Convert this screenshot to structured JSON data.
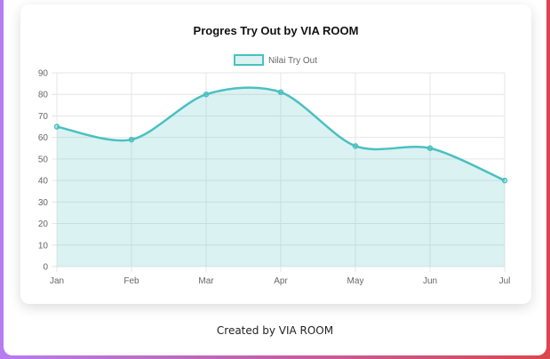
{
  "colors": {
    "line": "#4bc0c0",
    "fill": "rgba(75,192,192,0.2)",
    "grid": "#e6e6e6",
    "tick": "#666666"
  },
  "chart_data": {
    "type": "line",
    "title": "Progres Try Out by VIA ROOM",
    "categories": [
      "Jan",
      "Feb",
      "Mar",
      "Apr",
      "May",
      "Jun",
      "Jul"
    ],
    "series": [
      {
        "name": "Nilai Try Out",
        "values": [
          65,
          59,
          80,
          81,
          56,
          55,
          40
        ]
      }
    ],
    "ylim": [
      0,
      90
    ],
    "yticks": [
      0,
      10,
      20,
      30,
      40,
      50,
      60,
      70,
      80,
      90
    ],
    "fill": true,
    "grid": true,
    "legend": "top-center"
  },
  "footer": {
    "text": "Created by VIA ROOM"
  }
}
